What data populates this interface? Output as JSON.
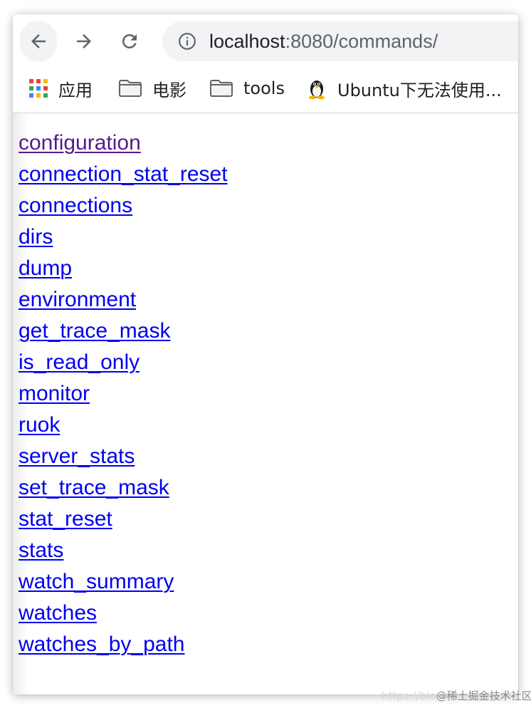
{
  "browser": {
    "url_host": "localhost",
    "url_path": ":8080/commands/"
  },
  "bookmarks": [
    {
      "label": "应用",
      "icon": "apps-grid-icon"
    },
    {
      "label": "电影",
      "icon": "folder-icon"
    },
    {
      "label": "tools",
      "icon": "folder-icon"
    },
    {
      "label": "Ubuntu下无法使用...",
      "icon": "linux-penguin-icon"
    }
  ],
  "links": [
    {
      "text": "configuration",
      "visited": true
    },
    {
      "text": "connection_stat_reset",
      "visited": false
    },
    {
      "text": "connections",
      "visited": false
    },
    {
      "text": "dirs",
      "visited": false
    },
    {
      "text": "dump",
      "visited": false
    },
    {
      "text": "environment",
      "visited": false
    },
    {
      "text": "get_trace_mask",
      "visited": false
    },
    {
      "text": "is_read_only",
      "visited": false
    },
    {
      "text": "monitor",
      "visited": false
    },
    {
      "text": "ruok",
      "visited": false
    },
    {
      "text": "server_stats",
      "visited": false
    },
    {
      "text": "set_trace_mask",
      "visited": false
    },
    {
      "text": "stat_reset",
      "visited": false
    },
    {
      "text": "stats",
      "visited": false
    },
    {
      "text": "watch_summary",
      "visited": false
    },
    {
      "text": "watches",
      "visited": false
    },
    {
      "text": "watches_by_path",
      "visited": false
    }
  ],
  "colors": {
    "link": "#0000ee",
    "link_visited": "#551a8b"
  },
  "watermark": {
    "faint": "https://blo",
    "text": "@稀土掘金技术社区"
  }
}
